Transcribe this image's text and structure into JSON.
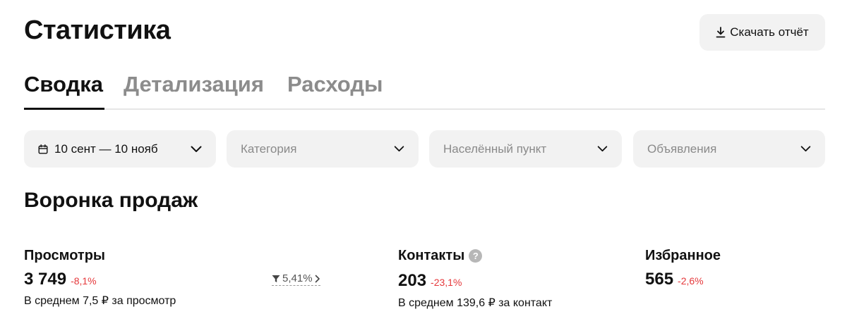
{
  "header": {
    "title": "Статистика",
    "download_label": "Скачать отчёт"
  },
  "tabs": [
    {
      "label": "Сводка",
      "active": true
    },
    {
      "label": "Детализация",
      "active": false
    },
    {
      "label": "Расходы",
      "active": false
    }
  ],
  "filters": {
    "period": "10 сент — 10 нояб",
    "category_placeholder": "Категория",
    "location_placeholder": "Населённый пункт",
    "ads_placeholder": "Объявления"
  },
  "funnel": {
    "title": "Воронка продаж",
    "views": {
      "label": "Просмотры",
      "value": "3 749",
      "delta": "-8,1%",
      "sub": "В среднем 7,5 ₽ за просмотр"
    },
    "conversion": "5,41%",
    "contacts": {
      "label": "Контакты",
      "value": "203",
      "delta": "-23,1%",
      "sub": "В среднем 139,6 ₽ за контакт"
    },
    "favorites": {
      "label": "Избранное",
      "value": "565",
      "delta": "-2,6%"
    }
  },
  "colors": {
    "negative": "#e5383b",
    "surface": "#f2f2f2",
    "muted": "#8c8c8c"
  }
}
